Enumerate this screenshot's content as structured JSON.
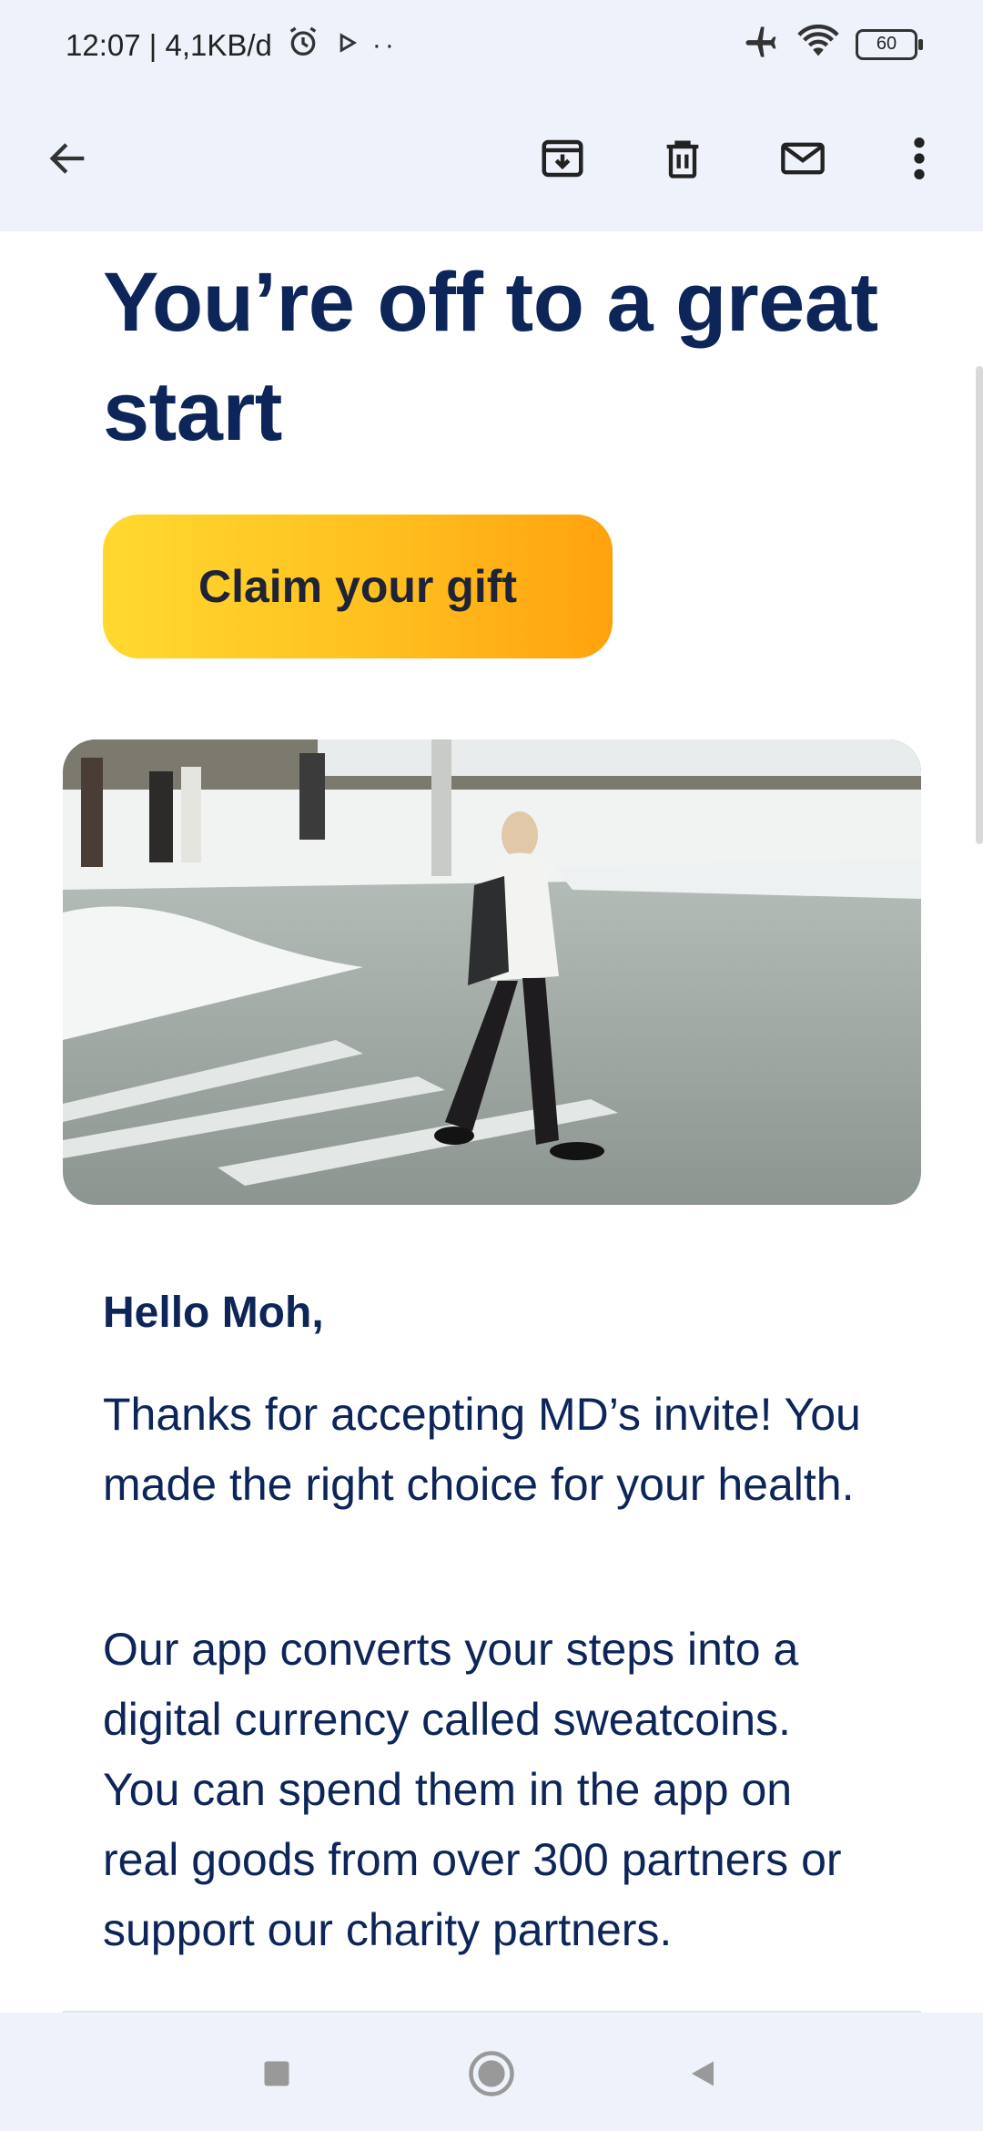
{
  "status_bar": {
    "time_speed": "12:07 | 4,1KB/d",
    "battery": "60"
  },
  "toolbar": {
    "back": "back-arrow-icon",
    "archive": "archive-icon",
    "delete": "trash-icon",
    "mark_unread": "mail-icon",
    "more": "more-vert-icon"
  },
  "email": {
    "headline": "You’re off to a great start",
    "cta_label": "Claim your gift",
    "greeting": "Hello Moh,",
    "paragraph1": "Thanks for accepting MD’s invite! You made the right choice for your health.",
    "paragraph2": "Our app converts your steps into a digital currency called sweatcoins. You can spend them in the app on real goods from over 300 partners or support our charity partners."
  },
  "colors": {
    "heading": "#0d2559",
    "cta_start": "#ffd92f",
    "cta_end": "#ffa20e",
    "bar_bg": "#eef2fa"
  }
}
